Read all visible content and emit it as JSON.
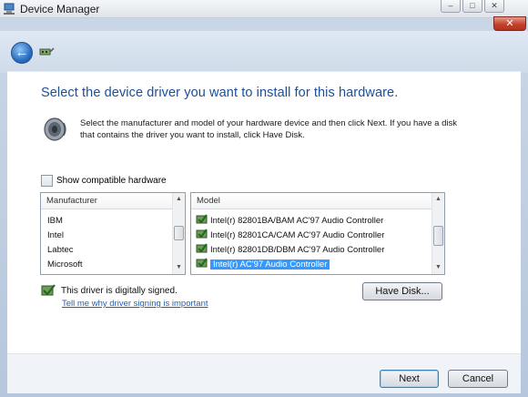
{
  "window": {
    "title": "Device Manager",
    "minimize_glyph": "–",
    "maximize_glyph": "□",
    "close_glyph": "✕"
  },
  "nav": {
    "back_glyph": "←",
    "wizard_icon": "hardware-wizard-icon"
  },
  "page": {
    "heading": "Select the device driver you want to install for this hardware.",
    "instructions": "Select the manufacturer and model of your hardware device and then click Next. If you have a disk that contains the driver you want to install, click Have Disk.",
    "instructions_icon": "speaker-icon"
  },
  "show_compatible": {
    "label": "Show compatible hardware",
    "checked": false
  },
  "manufacturer_list": {
    "header": "Manufacturer",
    "items": [
      "IBM",
      "Intel",
      "Labtec",
      "Microsoft"
    ]
  },
  "model_list": {
    "header": "Model",
    "items": [
      "Intel(r) 82801BA/BAM AC'97 Audio Controller",
      "Intel(r) 82801CA/CAM AC'97 Audio Controller",
      "Intel(r) 82801DB/DBM AC'97 Audio Controller",
      "Intel(r) AC'97 Audio Controller"
    ],
    "selected": "Intel(r) AC'97 Audio Controller"
  },
  "signing": {
    "status": "This driver is digitally signed.",
    "link": "Tell me why driver signing is important"
  },
  "buttons": {
    "have_disk": "Have Disk...",
    "next": "Next",
    "cancel": "Cancel"
  },
  "colors": {
    "heading": "#1b4f98",
    "link": "#1f5fb6",
    "selection": "#3399ff",
    "close_button": "#c3412b"
  }
}
